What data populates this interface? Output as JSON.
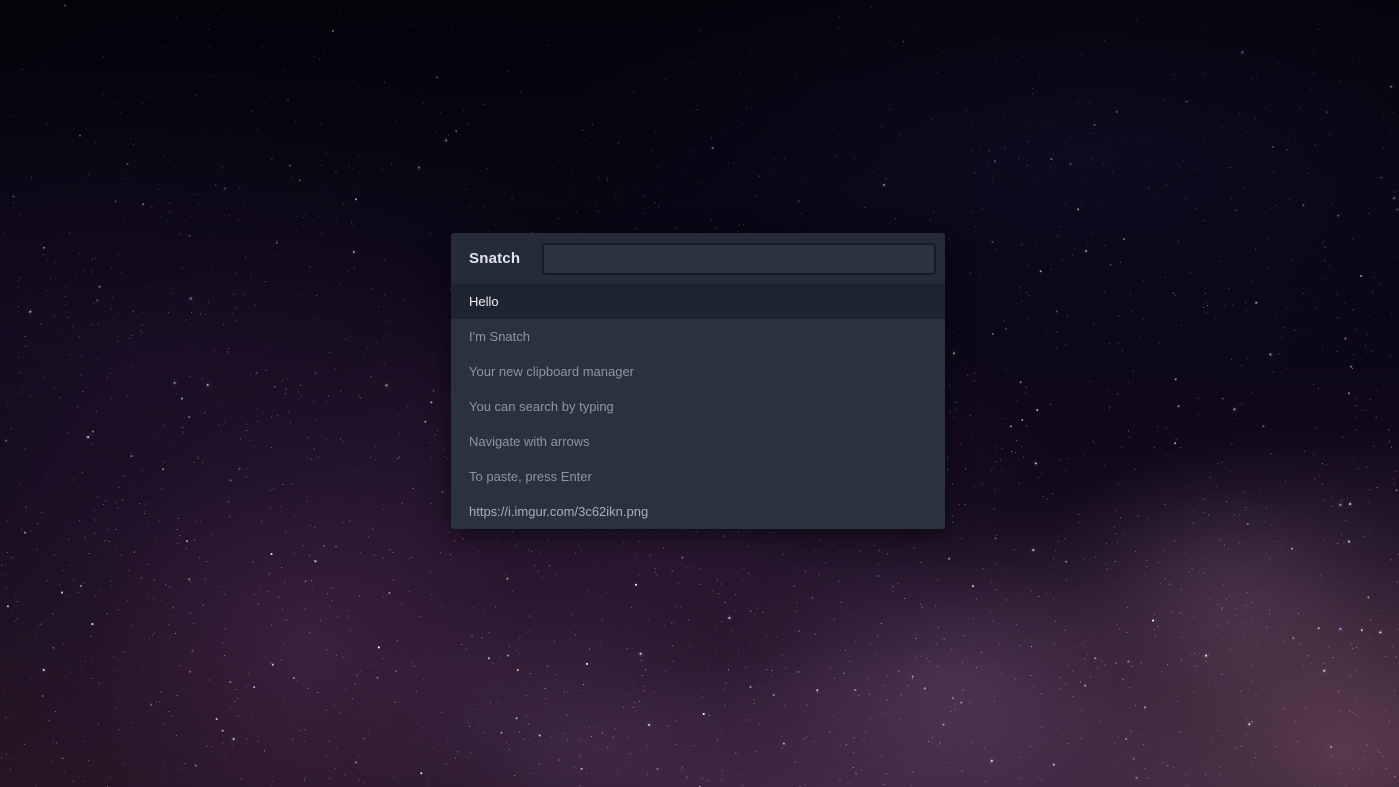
{
  "desktop": {
    "wallpaper_name": "starfield-milky-way-wallpaper",
    "colors": {
      "sky_top": "#04030a",
      "nebula_purple": "#2e1a2e",
      "star_white": "#ffffff",
      "star_blue": "#aab6ff"
    }
  },
  "app": {
    "title": "Snatch",
    "window_name": "snatch-clipboard-manager",
    "colors": {
      "panel_bg": "#2b313d",
      "header_bg": "#252b38",
      "selected_bg": "#1e242f",
      "input_bg": "#2c333f",
      "input_border": "#161b24",
      "title_text": "#dfe4ec",
      "item_text": "#8b95a6",
      "selected_text": "#eef1f6"
    }
  },
  "search": {
    "value": "",
    "placeholder": ""
  },
  "clipboard_items": [
    {
      "text": "Hello",
      "selected": true,
      "bright": false
    },
    {
      "text": "I'm Snatch",
      "selected": false,
      "bright": false
    },
    {
      "text": "Your new clipboard manager",
      "selected": false,
      "bright": false
    },
    {
      "text": "You can search by typing",
      "selected": false,
      "bright": false
    },
    {
      "text": "Navigate with arrows",
      "selected": false,
      "bright": false
    },
    {
      "text": "To paste, press Enter",
      "selected": false,
      "bright": false
    },
    {
      "text": "https://i.imgur.com/3c62ikn.png",
      "selected": false,
      "bright": true
    }
  ]
}
